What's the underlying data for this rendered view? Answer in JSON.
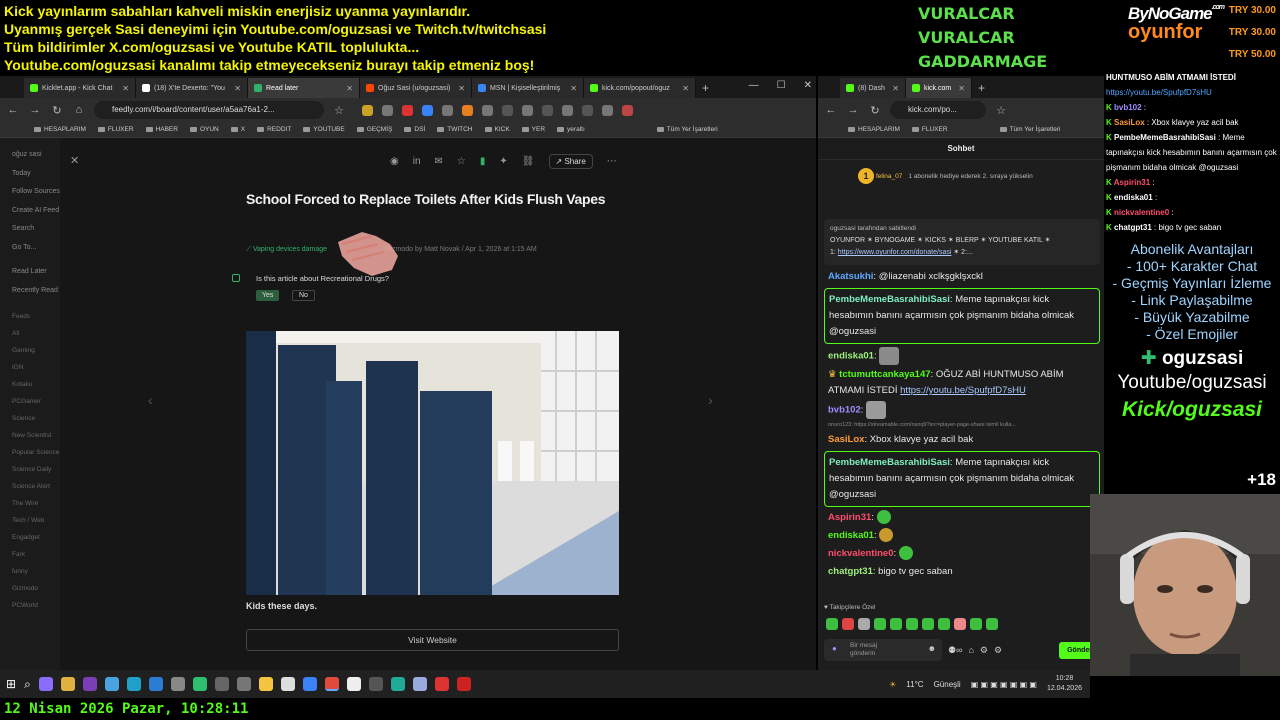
{
  "banner": {
    "line1": "Kick yayınlarım sabahları kahveli miskin enerjisiz uyanma yayınlarıdır.",
    "line2": "Uyanmış gerçek Sasi deneyimi için Youtube.com/oguzsasi ve Twitch.tv/twitchsasi",
    "line3": "Tüm bildirimler X.com/oguzsasi ve Youtube KATIL toplulukta...",
    "line4": "Youtube.com/oguzsasi kanalımı takip etmeyecekseniz burayı takip etmeniz boş!"
  },
  "donors": [
    "VURALCAR",
    "VURALCAR",
    "GADDARMAGE"
  ],
  "logo": {
    "brand": "ByNoGame",
    "com": ".com",
    "sub": "oyunfor"
  },
  "try_amounts": [
    "TRY 30.00",
    "TRY 30.00",
    "TRY 50.00"
  ],
  "left_browser": {
    "tabs": [
      {
        "label": "Kicklet.app - Kick Chat",
        "color": "#53fc18"
      },
      {
        "label": "(18) X'te Dexerto: \"You",
        "color": "#ffffff"
      },
      {
        "label": "Read later",
        "color": "#2fb36b"
      },
      {
        "label": "Oğuz Sasi (u/oguzsasi)",
        "color": "#ff4500"
      },
      {
        "label": "MSN | Kişiselleştirilmiş",
        "color": "#3b82f6"
      },
      {
        "label": "kick.com/popout/oguz",
        "color": "#53fc18"
      }
    ],
    "url": "feedly.com/i/board/content/user/a5aa76a1-2...",
    "bookmarks": [
      "HESAPLARIM",
      "FLUXER",
      "HABER",
      "OYUN",
      "X",
      "REDDIT",
      "YOUTUBE",
      "GEÇMİŞ",
      "DSİ",
      "TWITCH",
      "KICK",
      "YER",
      "yeraltı",
      "Tüm Yer İşaretleri"
    ]
  },
  "feedly_sidebar": {
    "user": "oğuz sasi",
    "items": [
      "Today",
      "Follow Sources",
      "Create AI Feed",
      "Search",
      "Go To..."
    ],
    "sections": [
      "Read Later",
      "Recently Read"
    ],
    "feeds_header": "Feeds",
    "feeds": [
      "All",
      "Gaming",
      "IGN",
      "Kotaku",
      "PCGamer",
      "Science",
      "New Scientist",
      "Popular Science",
      "Science Daily",
      "Science Alert",
      "The Wire",
      "Tech / Web",
      "Engadget",
      "Fark",
      "funny",
      "Gizmodo",
      "PCWorld"
    ]
  },
  "article": {
    "toolbar_share": "Share",
    "title": "School Forced to Replace Toilets After Kids Flush Vapes",
    "tag": "Vaping devices damage",
    "byline": "Gizmodo by Matt Novak / Apr 1, 2026 at 1:15 AM",
    "question": "Is this article about Recreational Drugs?",
    "yes": "Yes",
    "no": "No",
    "caption": "Kids these days.",
    "visit": "Visit Website"
  },
  "right_browser": {
    "tabs": [
      {
        "label": "(8) Dash",
        "color": "#53fc18"
      },
      {
        "label": "kick.com",
        "color": "#53fc18"
      }
    ],
    "url": "kick.com/po...",
    "bookmarks": [
      "HESAPLARIM",
      "FLUXER",
      "Tüm Yer İşaretleri"
    ],
    "chat_title": "Sohbet",
    "gift": {
      "user": "felina_07",
      "count": "1",
      "text": "1 abonelik hediye ederek 2. sıraya yükselin"
    },
    "pinned": {
      "header": "oguzsasi tarafından sabitlendi",
      "body": "OYUNFOR ✶ BYNOGAME ✶ KICKS ✶ BLERP ✶ YOUTUBE KATIL ✶",
      "prefix": "1:",
      "link": "https://www.oyunfor.com/donate/sasi",
      "suffix": "✶ 2:..."
    },
    "messages": [
      {
        "user": "Akatsukhi",
        "text": "@liazenabi xclkşgklşxckl"
      },
      {
        "user": "PembeMemeBasrahibiSasi",
        "text": "Meme tapınakçısı kick hesabımın banını açarmısın çok pişmanım bidaha olmicak @oguzsasi"
      },
      {
        "user": "endiska01",
        "text": ""
      },
      {
        "user": "tctumuttcankaya147",
        "text": "OĞUZ ABİ HUNTMUSO ABİM ATMAMI İSTEDİ",
        "link": "https://youtu.be/SpufpfD7sHU"
      },
      {
        "user": "bvb102",
        "text": ""
      },
      {
        "reply": "onuro123: https://streamable.com/nsoq9?src=player-page-share isimli kulla..."
      },
      {
        "user": "SasiLox",
        "text": "Xbox klavye yaz acil bak"
      },
      {
        "user": "PembeMemeBasrahibiSasi",
        "text": "Meme tapınakçısı kick hesabımın banını açarmısın çok pişmanım bidaha olmicak @oguzsasi"
      },
      {
        "user": "Aspirin31",
        "text": ""
      },
      {
        "user": "endiska01",
        "text": ""
      },
      {
        "user": "nickvalentine0",
        "text": ""
      },
      {
        "user": "chatgpt31",
        "text": "bigo tv gec saban"
      }
    ],
    "followers_label": "Takipçilere Özel",
    "input_placeholder_1": "Bir mesaj",
    "input_placeholder_2": "gönderin",
    "send_label": "Gönder"
  },
  "overlay": {
    "top_white": "HUNTMUSO ABİM ATMAMI İSTEDİ",
    "top_link": "https://youtu.be/SpufpfD7sHU",
    "lines": [
      {
        "user": "bvb102",
        "text": ":"
      },
      {
        "user": "SasiLox",
        "text": ": Xbox klavye yaz acil bak"
      },
      {
        "user": "PembeMemeBasrahibiSasi",
        "text": ": Meme tapınakçısı kick hesabımın banını açarmısın çok pişmanım bidaha olmicak @oguzsasi"
      },
      {
        "user": "Aspirin31",
        "text": ":"
      },
      {
        "user": "endiska01",
        "text": ":"
      },
      {
        "user": "nickvalentine0",
        "text": ":"
      },
      {
        "user": "chatgpt31",
        "text": ": bigo tv gec saban"
      }
    ],
    "perks": [
      "Abonelik Avantajları",
      "- 100+ Karakter Chat",
      "- Geçmiş Yayınları İzleme",
      "- Link Paylaşabilme",
      "- Büyük Yazabilme",
      "- Özel Emojiler"
    ],
    "channel": "oguzsasi",
    "youtube": "Youtube/oguzsasi",
    "kick": "Kick/oguzsasi",
    "age": "+18"
  },
  "taskbar": {
    "weather": "11°C",
    "weather_text": "Güneşli",
    "time": "10:28",
    "date": "12.04.2026"
  },
  "datetime_line": "12 Nisan 2026 Pazar, 10:28:11"
}
